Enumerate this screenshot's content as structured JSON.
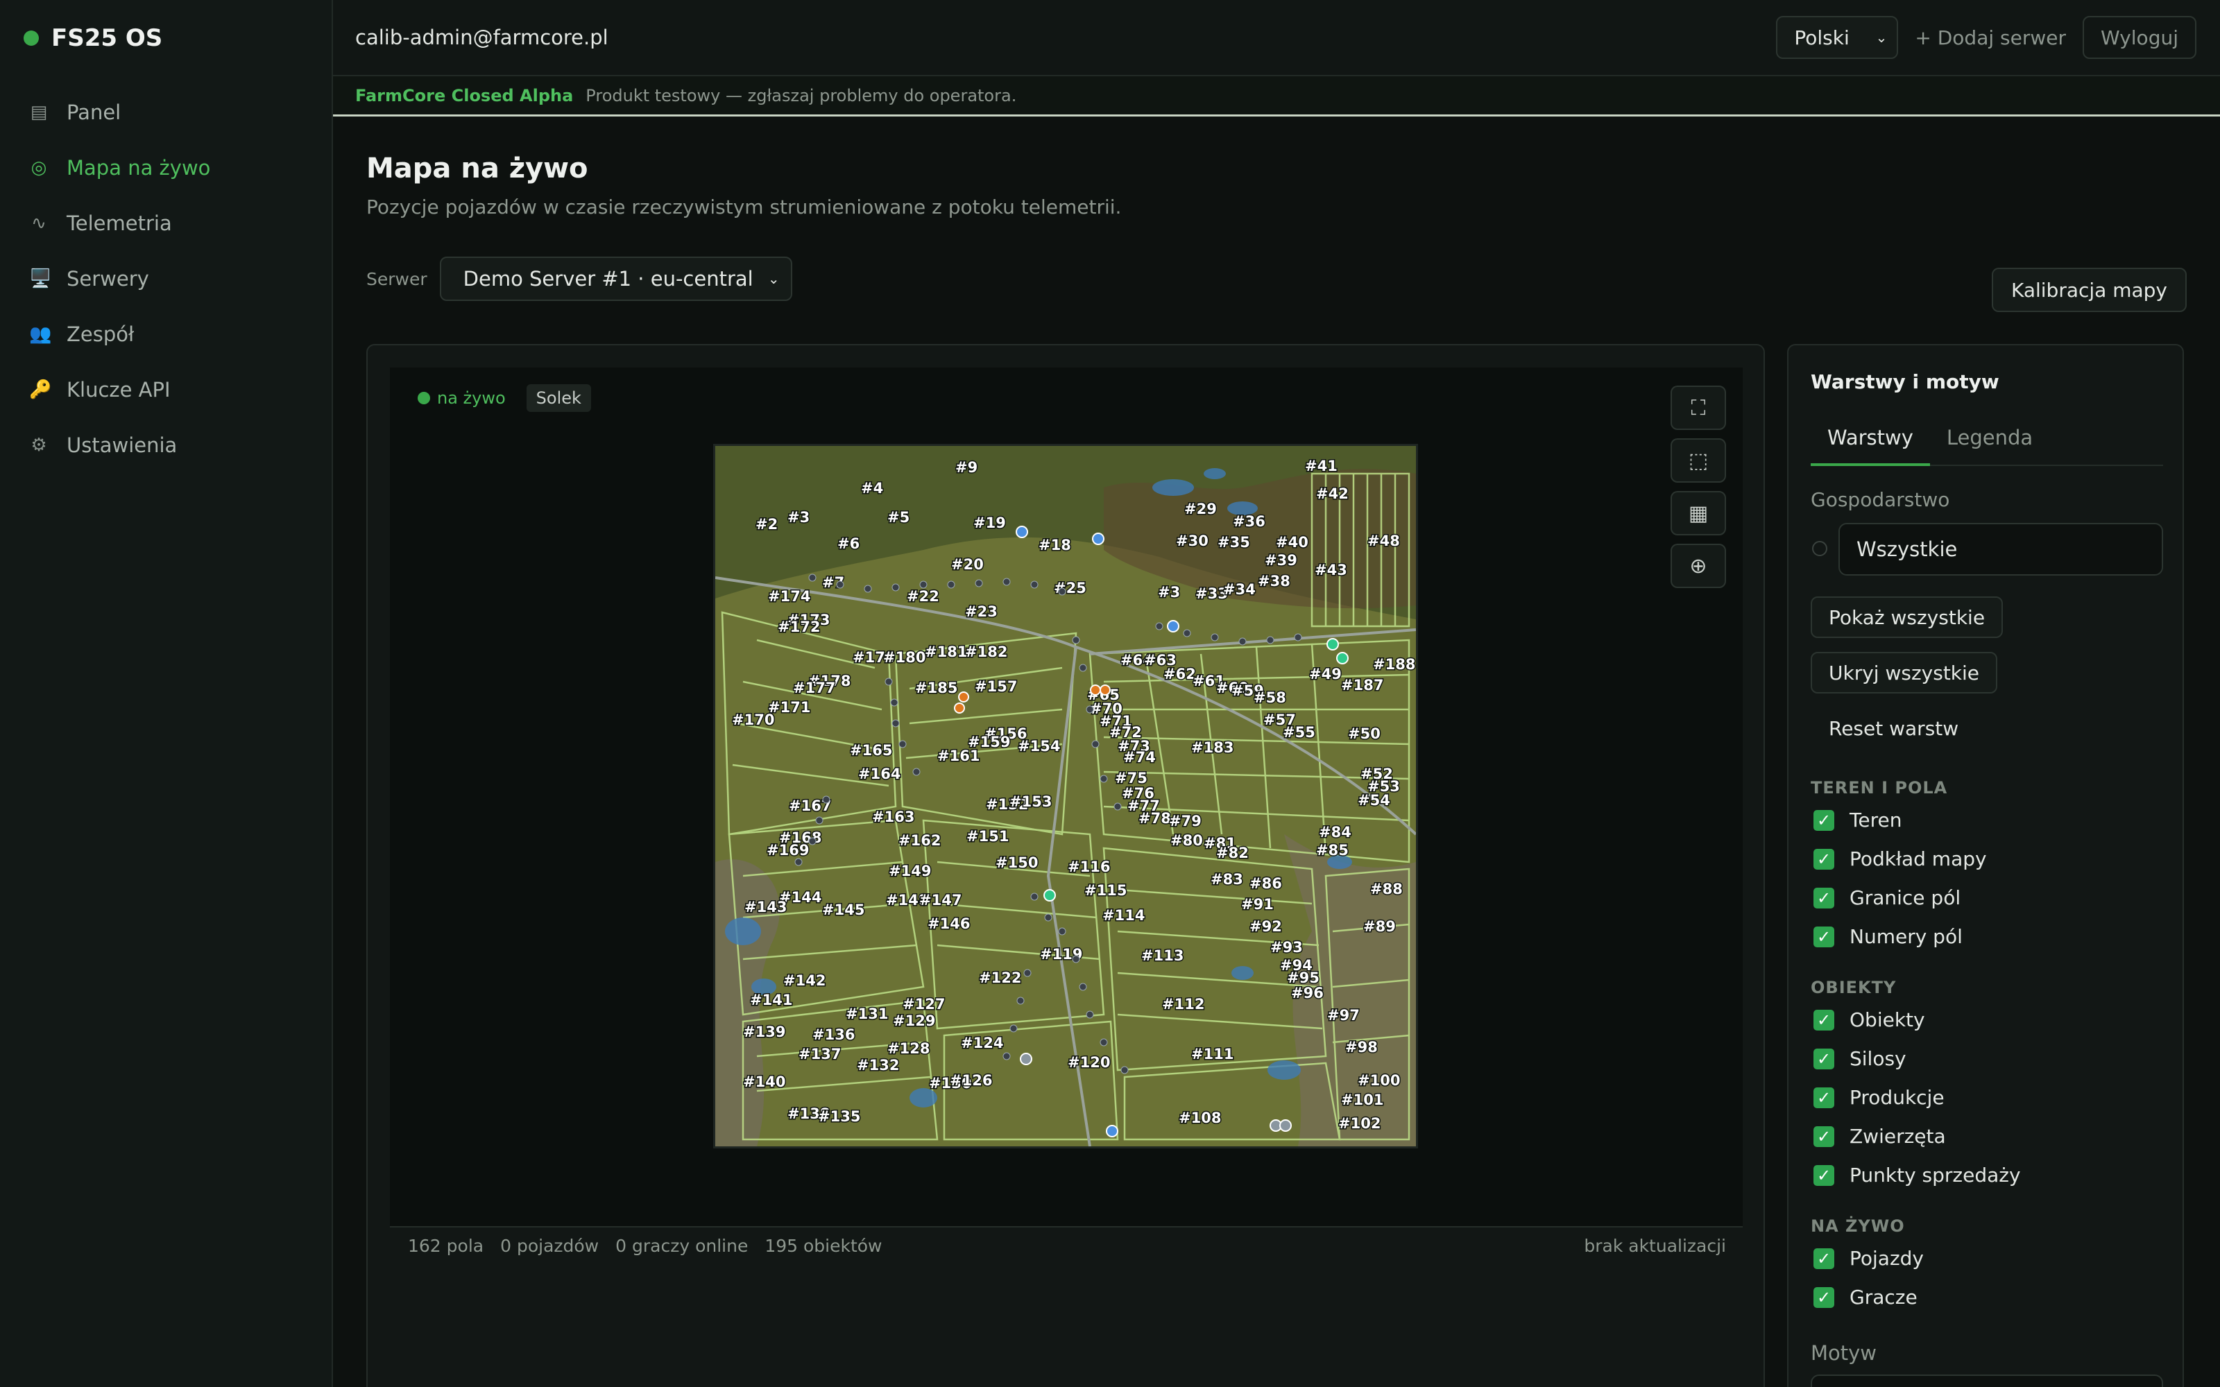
{
  "brand": {
    "name": "FS25 OS"
  },
  "sidebar": {
    "items": [
      {
        "label": "Panel",
        "icon": "▤"
      },
      {
        "label": "Mapa na żywo",
        "icon": "◎"
      },
      {
        "label": "Telemetria",
        "icon": "∿"
      },
      {
        "label": "Serwery",
        "icon": "🖥️"
      },
      {
        "label": "Zespół",
        "icon": "👥"
      },
      {
        "label": "Klucze API",
        "icon": "🔑"
      },
      {
        "label": "Ustawienia",
        "icon": "⚙"
      }
    ]
  },
  "topbar": {
    "user": "calib-admin@farmcore.pl",
    "language": "Polski",
    "add_server": "+ Dodaj serwer",
    "logout": "Wyloguj"
  },
  "alpha": {
    "tag": "FarmCore Closed Alpha",
    "text": "Produkt testowy — zgłaszaj problemy do operatora."
  },
  "page": {
    "title": "Mapa na żywo",
    "subtitle": "Pozycje pojazdów w czasie rzeczywistym strumieniowane z potoku telemetrii.",
    "server_label": "Serwer",
    "server_value": "Demo Server #1 · eu-central",
    "calibrate": "Kalibracja mapy"
  },
  "map": {
    "live": "na żywo",
    "theme": "Solek",
    "tools": [
      "⛶",
      "⬚",
      "▦",
      "⊕"
    ],
    "fields": [
      [
        "#9",
        346,
        38
      ],
      [
        "#4",
        210,
        68
      ],
      [
        "#41",
        850,
        36
      ],
      [
        "#42",
        866,
        76
      ],
      [
        "#29",
        676,
        98
      ],
      [
        "#36",
        746,
        116
      ],
      [
        "#2",
        58,
        120
      ],
      [
        "#3",
        104,
        110
      ],
      [
        "#5",
        248,
        110
      ],
      [
        "#19",
        372,
        118
      ],
      [
        "#6",
        176,
        148
      ],
      [
        "#18",
        466,
        150
      ],
      [
        "#30",
        664,
        144
      ],
      [
        "#35",
        724,
        146
      ],
      [
        "#40",
        808,
        146
      ],
      [
        "#48",
        940,
        144
      ],
      [
        "#39",
        792,
        172
      ],
      [
        "#43",
        864,
        186
      ],
      [
        "#20",
        340,
        178
      ],
      [
        "#7",
        154,
        204
      ],
      [
        "#25",
        488,
        212
      ],
      [
        "#22",
        276,
        224
      ],
      [
        "#3",
        638,
        218
      ],
      [
        "#33",
        692,
        220
      ],
      [
        "#34",
        732,
        214
      ],
      [
        "#38",
        782,
        202
      ],
      [
        "#174",
        76,
        224
      ],
      [
        "#23",
        360,
        246
      ],
      [
        "#173",
        104,
        258
      ],
      [
        "#172",
        90,
        268
      ],
      [
        "#179",
        198,
        312
      ],
      [
        "#180",
        242,
        312
      ],
      [
        "#181",
        302,
        304
      ],
      [
        "#182",
        360,
        304
      ],
      [
        "#64",
        584,
        316
      ],
      [
        "#63",
        618,
        316
      ],
      [
        "#188",
        948,
        322
      ],
      [
        "#178",
        134,
        346
      ],
      [
        "#177",
        112,
        356
      ],
      [
        "#185",
        288,
        356
      ],
      [
        "#157",
        374,
        354
      ],
      [
        "#62",
        646,
        336
      ],
      [
        "#61",
        688,
        346
      ],
      [
        "#60",
        722,
        356
      ],
      [
        "#59",
        744,
        360
      ],
      [
        "#58",
        776,
        370
      ],
      [
        "#49",
        856,
        336
      ],
      [
        "#187",
        902,
        352
      ],
      [
        "#171",
        76,
        384
      ],
      [
        "#170",
        24,
        402
      ],
      [
        "#65",
        536,
        366
      ],
      [
        "#70",
        540,
        386
      ],
      [
        "#71",
        554,
        404
      ],
      [
        "#156",
        388,
        422
      ],
      [
        "#159",
        364,
        434
      ],
      [
        "#154",
        436,
        440
      ],
      [
        "#72",
        568,
        420
      ],
      [
        "#73",
        580,
        440
      ],
      [
        "#57",
        790,
        402
      ],
      [
        "#55",
        818,
        420
      ],
      [
        "#50",
        912,
        422
      ],
      [
        "#74",
        588,
        456
      ],
      [
        "#183",
        686,
        442
      ],
      [
        "#165",
        194,
        446
      ],
      [
        "#161",
        320,
        454
      ],
      [
        "#75",
        576,
        486
      ],
      [
        "#52",
        930,
        480
      ],
      [
        "#53",
        940,
        498
      ],
      [
        "#164",
        206,
        480
      ],
      [
        "#76",
        586,
        508
      ],
      [
        "#54",
        926,
        518
      ],
      [
        "#167",
        106,
        526
      ],
      [
        "#132",
        390,
        524
      ],
      [
        "#153",
        424,
        520
      ],
      [
        "#77",
        594,
        526
      ],
      [
        "#163",
        226,
        542
      ],
      [
        "#78",
        610,
        544
      ],
      [
        "#79",
        654,
        548
      ],
      [
        "#168",
        92,
        572
      ],
      [
        "#169",
        74,
        590
      ],
      [
        "#162",
        264,
        576
      ],
      [
        "#151",
        362,
        570
      ],
      [
        "#80",
        656,
        576
      ],
      [
        "#81",
        704,
        580
      ],
      [
        "#82",
        722,
        594
      ],
      [
        "#84",
        870,
        564
      ],
      [
        "#85",
        866,
        590
      ],
      [
        "#150",
        404,
        608
      ],
      [
        "#116",
        508,
        614
      ],
      [
        "#149",
        250,
        620
      ],
      [
        "#115",
        532,
        648
      ],
      [
        "#83",
        714,
        632
      ],
      [
        "#86",
        770,
        638
      ],
      [
        "#88",
        944,
        646
      ],
      [
        "#144",
        92,
        658
      ],
      [
        "#148",
        246,
        662
      ],
      [
        "#147",
        294,
        662
      ],
      [
        "#143",
        42,
        672
      ],
      [
        "#145",
        154,
        676
      ],
      [
        "#114",
        558,
        684
      ],
      [
        "#91",
        758,
        668
      ],
      [
        "#146",
        306,
        696
      ],
      [
        "#92",
        770,
        700
      ],
      [
        "#89",
        934,
        700
      ],
      [
        "#119",
        468,
        740
      ],
      [
        "#113",
        614,
        742
      ],
      [
        "#93",
        800,
        730
      ],
      [
        "#94",
        814,
        756
      ],
      [
        "#142",
        98,
        778
      ],
      [
        "#122",
        380,
        774
      ],
      [
        "#95",
        824,
        774
      ],
      [
        "#96",
        830,
        796
      ],
      [
        "#141",
        50,
        806
      ],
      [
        "#127",
        270,
        812
      ],
      [
        "#112",
        644,
        812
      ],
      [
        "#131",
        188,
        826
      ],
      [
        "#129",
        256,
        836
      ],
      [
        "#97",
        882,
        828
      ],
      [
        "#136",
        140,
        856
      ],
      [
        "#139",
        40,
        852
      ],
      [
        "#124",
        354,
        868
      ],
      [
        "#128",
        248,
        876
      ],
      [
        "#137",
        120,
        884
      ],
      [
        "#98",
        908,
        874
      ],
      [
        "#111",
        686,
        884
      ],
      [
        "#132",
        204,
        900
      ],
      [
        "#120",
        508,
        896
      ],
      [
        "#130",
        308,
        926
      ],
      [
        "#126",
        338,
        922
      ],
      [
        "#140",
        40,
        924
      ],
      [
        "#100",
        926,
        922
      ],
      [
        "#101",
        902,
        950
      ],
      [
        "#138",
        104,
        970
      ],
      [
        "#135",
        148,
        974
      ],
      [
        "#108",
        668,
        976
      ],
      [
        "#102",
        898,
        984
      ]
    ]
  },
  "status": {
    "fields": "162 pola",
    "vehicles": "0 pojazdów",
    "players": "0 graczy online",
    "objects": "195 obiektów",
    "update": "brak aktualizacji"
  },
  "panel": {
    "title": "Warstwy i motyw",
    "tabs": [
      "Warstwy",
      "Legenda"
    ],
    "farm_label": "Gospodarstwo",
    "farm_value": "Wszystkie",
    "show_all": "Pokaż wszystkie",
    "hide_all": "Ukryj wszystkie",
    "reset": "Reset warstw",
    "sections": [
      {
        "label": "TEREN I POLA",
        "items": [
          "Teren",
          "Podkład mapy",
          "Granice pól",
          "Numery pól"
        ]
      },
      {
        "label": "OBIEKTY",
        "items": [
          "Obiekty",
          "Silosy",
          "Produkcje",
          "Zwierzęta",
          "Punkty sprzedaży"
        ]
      },
      {
        "label": "NA ŻYWO",
        "items": [
          "Pojazdy",
          "Gracze"
        ]
      }
    ],
    "theme_label": "Motyw"
  },
  "colors": {
    "accent": "#3aa84a",
    "check": "#2da44e",
    "bg": "#0d110f"
  }
}
